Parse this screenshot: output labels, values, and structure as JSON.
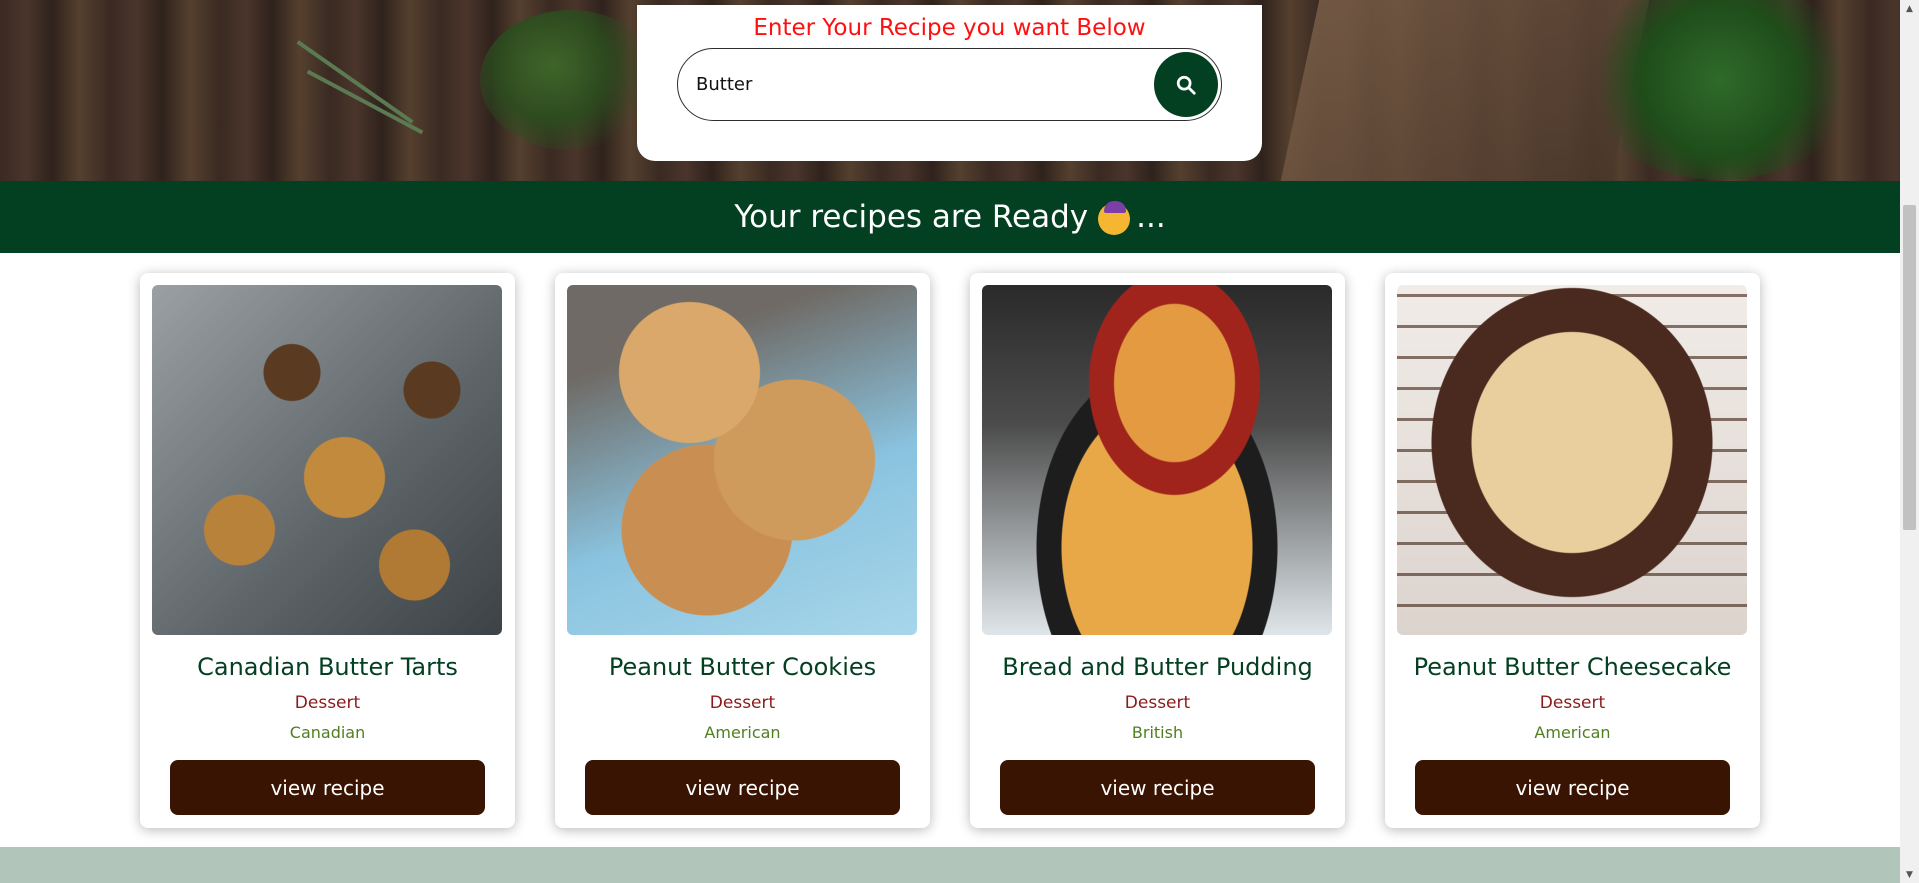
{
  "search": {
    "title": "Enter Your Recipe you want Below",
    "value": "Butter",
    "button_icon": "search-icon"
  },
  "banner": {
    "text": "Your recipes are Ready",
    "emoji": "partying-face-emoji",
    "suffix": "..."
  },
  "recipes": [
    {
      "title": "Canadian Butter Tarts",
      "category": "Dessert",
      "area": "Canadian",
      "button": "view recipe"
    },
    {
      "title": "Peanut Butter Cookies",
      "category": "Dessert",
      "area": "American",
      "button": "view recipe"
    },
    {
      "title": "Bread and Butter Pudding",
      "category": "Dessert",
      "area": "British",
      "button": "view recipe"
    },
    {
      "title": "Peanut Butter Cheesecake",
      "category": "Dessert",
      "area": "American",
      "button": "view recipe"
    }
  ],
  "colors": {
    "primary_green": "#033f21",
    "button_brown": "#3a1402",
    "title_red": "#ff1010",
    "category_red": "#8b1a1a",
    "area_green": "#4f7f1f",
    "footer_strip": "#b1c5ba"
  }
}
